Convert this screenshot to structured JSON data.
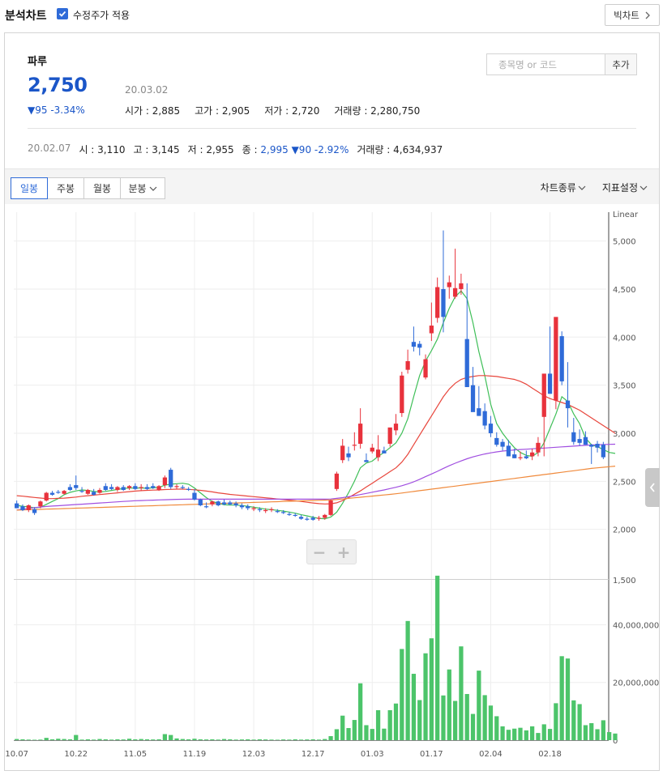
{
  "header": {
    "title": "분석차트",
    "adjusted_label": "수정주가 적용",
    "big_chart_label": "빅차트"
  },
  "stock": {
    "name": "파루",
    "price": "2,750",
    "change": "▼95 -3.34%",
    "date": "20.03.02",
    "open_label": "시가",
    "open": "2,885",
    "high_label": "고가",
    "high": "2,905",
    "low_label": "저가",
    "low": "2,720",
    "volume_label": "거래량",
    "volume": "2,280,750"
  },
  "search": {
    "placeholder": "종목명 or 코드",
    "add_label": "추가"
  },
  "previous": {
    "date": "20.02.07",
    "open_label": "시",
    "open": "3,110",
    "high_label": "고",
    "high": "3,145",
    "low_label": "저",
    "low": "2,955",
    "close_label": "종",
    "close": "2,995",
    "change": "▼90 -2.92%",
    "volume_label": "거래량",
    "volume": "4,634,937"
  },
  "toolbar": {
    "tabs": [
      "일봉",
      "주봉",
      "월봉",
      "분봉"
    ],
    "chart_type_label": "차트종류",
    "indicator_label": "지표설정"
  },
  "colors": {
    "up": "#e8323c",
    "down": "#2f6bd8",
    "ma5": "#3fbf58",
    "ma20": "#e8463c",
    "ma60": "#a04ee0",
    "ma120": "#f08a3c",
    "volume": "#4cc46a"
  },
  "chart_data": {
    "type": "candlestick",
    "price_scale_label": "Linear",
    "x_tick_labels": [
      "10.07",
      "10.22",
      "11.05",
      "11.19",
      "12.03",
      "12.17",
      "01.03",
      "01.17",
      "02.04",
      "02.18"
    ],
    "price_ticks": [
      "5,000",
      "4,500",
      "4,000",
      "3,500",
      "3,000",
      "2,500",
      "2,000",
      "1,500"
    ],
    "volume_ticks": [
      "40,000,000",
      "20,000,000",
      "0"
    ],
    "price_range": [
      1500,
      5300
    ],
    "volume_range": [
      0,
      55000000
    ],
    "candles": [
      [
        2270,
        2300,
        2220,
        2220
      ],
      [
        2240,
        2260,
        2190,
        2200
      ],
      [
        2200,
        2260,
        2180,
        2250
      ],
      [
        2210,
        2230,
        2150,
        2170
      ],
      [
        2240,
        2300,
        2220,
        2290
      ],
      [
        2300,
        2390,
        2290,
        2380
      ],
      [
        2380,
        2400,
        2350,
        2360
      ],
      [
        2390,
        2410,
        2370,
        2380
      ],
      [
        2370,
        2410,
        2360,
        2400
      ],
      [
        2440,
        2470,
        2400,
        2410
      ],
      [
        2460,
        2560,
        2410,
        2430
      ],
      [
        2400,
        2440,
        2380,
        2390
      ],
      [
        2370,
        2420,
        2360,
        2410
      ],
      [
        2390,
        2420,
        2350,
        2360
      ],
      [
        2380,
        2430,
        2370,
        2410
      ],
      [
        2450,
        2480,
        2400,
        2410
      ],
      [
        2440,
        2470,
        2410,
        2420
      ],
      [
        2410,
        2450,
        2390,
        2440
      ],
      [
        2440,
        2460,
        2400,
        2410
      ],
      [
        2430,
        2460,
        2410,
        2450
      ],
      [
        2450,
        2480,
        2410,
        2420
      ],
      [
        2430,
        2470,
        2400,
        2440
      ],
      [
        2440,
        2470,
        2410,
        2420
      ],
      [
        2450,
        2480,
        2420,
        2430
      ],
      [
        2410,
        2460,
        2400,
        2450
      ],
      [
        2460,
        2560,
        2430,
        2540
      ],
      [
        2620,
        2640,
        2420,
        2440
      ],
      [
        2440,
        2470,
        2420,
        2450
      ],
      [
        2440,
        2460,
        2420,
        2430
      ],
      [
        2420,
        2440,
        2400,
        2410
      ],
      [
        2380,
        2420,
        2300,
        2310
      ],
      [
        2310,
        2320,
        2240,
        2250
      ],
      [
        2240,
        2280,
        2220,
        2230
      ],
      [
        2260,
        2300,
        2240,
        2290
      ],
      [
        2290,
        2300,
        2240,
        2250
      ],
      [
        2280,
        2310,
        2250,
        2260
      ],
      [
        2280,
        2300,
        2250,
        2260
      ],
      [
        2270,
        2290,
        2230,
        2250
      ],
      [
        2250,
        2270,
        2210,
        2230
      ],
      [
        2240,
        2260,
        2200,
        2220
      ],
      [
        2210,
        2240,
        2190,
        2220
      ],
      [
        2210,
        2230,
        2180,
        2200
      ],
      [
        2190,
        2220,
        2170,
        2200
      ],
      [
        2200,
        2230,
        2180,
        2210
      ],
      [
        2190,
        2210,
        2170,
        2180
      ],
      [
        2180,
        2200,
        2160,
        2170
      ],
      [
        2160,
        2180,
        2140,
        2150
      ],
      [
        2150,
        2170,
        2130,
        2140
      ],
      [
        2130,
        2150,
        2100,
        2110
      ],
      [
        2110,
        2130,
        2090,
        2100
      ],
      [
        2120,
        2140,
        2090,
        2100
      ],
      [
        2110,
        2140,
        2090,
        2120
      ],
      [
        2120,
        2160,
        2100,
        2150
      ],
      [
        2150,
        2310,
        2140,
        2300
      ],
      [
        2420,
        2600,
        2400,
        2580
      ],
      [
        2720,
        2940,
        2690,
        2870
      ],
      [
        2790,
        2860,
        2710,
        2750
      ],
      [
        2870,
        3010,
        2820,
        2880
      ],
      [
        2890,
        3260,
        2840,
        3100
      ],
      [
        2720,
        2790,
        2700,
        2700
      ],
      [
        2810,
        2890,
        2790,
        2850
      ],
      [
        2750,
        2980,
        2710,
        2830
      ],
      [
        2820,
        2860,
        2800,
        2790
      ],
      [
        2890,
        3040,
        2860,
        3060
      ],
      [
        3030,
        3200,
        2980,
        3100
      ],
      [
        3210,
        3640,
        3170,
        3600
      ],
      [
        3660,
        3870,
        3620,
        3750
      ],
      [
        3950,
        4110,
        3850,
        3900
      ],
      [
        3930,
        3960,
        3810,
        3890
      ],
      [
        3580,
        3820,
        3560,
        3770
      ],
      [
        4040,
        4360,
        3960,
        4120
      ],
      [
        4200,
        4620,
        4150,
        4520
      ],
      [
        4500,
        5110,
        4050,
        4210
      ],
      [
        4520,
        4640,
        4400,
        4570
      ],
      [
        4420,
        4920,
        4400,
        4510
      ],
      [
        4500,
        4660,
        4440,
        4560
      ],
      [
        3980,
        4560,
        3550,
        3480
      ],
      [
        3500,
        3690,
        3280,
        3220
      ],
      [
        3260,
        3490,
        3180,
        3180
      ],
      [
        3230,
        3310,
        3040,
        3080
      ],
      [
        3100,
        3180,
        2960,
        3000
      ],
      [
        2950,
        3010,
        2860,
        2880
      ],
      [
        2910,
        2940,
        2820,
        2860
      ],
      [
        2870,
        2930,
        2760,
        2760
      ],
      [
        2780,
        2840,
        2740,
        2740
      ],
      [
        2740,
        2810,
        2720,
        2750
      ],
      [
        2760,
        2820,
        2730,
        2740
      ],
      [
        2760,
        2840,
        2720,
        2800
      ],
      [
        2800,
        2960,
        2760,
        2900
      ],
      [
        3170,
        3400,
        2760,
        3620
      ],
      [
        3620,
        4110,
        3580,
        3410
      ],
      [
        3340,
        4170,
        3250,
        4210
      ],
      [
        4010,
        4060,
        3500,
        3540
      ],
      [
        3340,
        3740,
        3060,
        3260
      ],
      [
        3010,
        3160,
        2880,
        2910
      ],
      [
        2940,
        3040,
        2870,
        2900
      ],
      [
        2960,
        3020,
        2880,
        2880
      ],
      [
        2880,
        2890,
        2680,
        2860
      ],
      [
        2890,
        2920,
        2800,
        2850
      ],
      [
        2880,
        2910,
        2730,
        2750
      ]
    ],
    "volumes": [
      400000,
      300000,
      200000,
      150000,
      200000,
      800000,
      300000,
      500000,
      400000,
      300000,
      1800000,
      200000,
      300000,
      200000,
      400000,
      300000,
      200000,
      300000,
      250000,
      500000,
      300000,
      400000,
      300000,
      250000,
      300000,
      2100000,
      1800000,
      600000,
      400000,
      300000,
      500000,
      300000,
      250000,
      300000,
      200000,
      400000,
      300000,
      200000,
      250000,
      300000,
      200000,
      300000,
      250000,
      200000,
      150000,
      250000,
      200000,
      300000,
      200000,
      250000,
      300000,
      200000,
      400000,
      1400000,
      3800000,
      8500000,
      4200000,
      7000000,
      19700000,
      5200000,
      3900000,
      10400000,
      4000000,
      10400000,
      12700000,
      31600000,
      41300000,
      23000000,
      13900000,
      30100000,
      35300000,
      57000000,
      15500000,
      24500000,
      13600000,
      32500000,
      16000000,
      9100000,
      24100000,
      15600000,
      12000000,
      8300000,
      4800000,
      3600000,
      4000000,
      4300000,
      3400000,
      4800000,
      2500000,
      5500000,
      3900000,
      12800000,
      29100000,
      28300000,
      13800000,
      12500000,
      5200000,
      5900000,
      3800000,
      6900000,
      2800000,
      2300000
    ],
    "ma_lines": {
      "ma5": [
        2250,
        2240,
        2235,
        2225,
        2230,
        2260,
        2290,
        2320,
        2360,
        2385,
        2400,
        2410,
        2405,
        2395,
        2390,
        2395,
        2405,
        2415,
        2425,
        2430,
        2430,
        2430,
        2428,
        2432,
        2436,
        2460,
        2470,
        2475,
        2480,
        2470,
        2430,
        2380,
        2330,
        2290,
        2270,
        2256,
        2252,
        2252,
        2248,
        2240,
        2230,
        2220,
        2210,
        2204,
        2198,
        2190,
        2180,
        2168,
        2152,
        2140,
        2126,
        2114,
        2110,
        2128,
        2178,
        2272,
        2380,
        2500,
        2640,
        2690,
        2710,
        2760,
        2800,
        2850,
        2900,
        3000,
        3150,
        3380,
        3600,
        3750,
        3860,
        3980,
        4150,
        4300,
        4420,
        4480,
        4400,
        4150,
        3850,
        3600,
        3300,
        3100,
        3000,
        2920,
        2850,
        2800,
        2770,
        2760,
        2800,
        2900,
        3050,
        3200,
        3380,
        3330,
        3200,
        3100,
        2950,
        2880,
        2860,
        2830,
        2800,
        2790
      ],
      "ma20": [
        2350,
        2345,
        2338,
        2332,
        2326,
        2320,
        2320,
        2322,
        2325,
        2330,
        2336,
        2344,
        2350,
        2356,
        2362,
        2368,
        2374,
        2380,
        2386,
        2392,
        2398,
        2402,
        2406,
        2408,
        2410,
        2414,
        2416,
        2418,
        2418,
        2416,
        2412,
        2406,
        2398,
        2390,
        2380,
        2372,
        2364,
        2358,
        2352,
        2346,
        2340,
        2334,
        2328,
        2322,
        2316,
        2310,
        2304,
        2298,
        2290,
        2282,
        2274,
        2268,
        2264,
        2266,
        2276,
        2300,
        2330,
        2365,
        2400,
        2440,
        2480,
        2520,
        2560,
        2600,
        2640,
        2700,
        2780,
        2880,
        2980,
        3080,
        3180,
        3280,
        3380,
        3460,
        3520,
        3560,
        3580,
        3590,
        3600,
        3600,
        3595,
        3590,
        3580,
        3570,
        3560,
        3540,
        3510,
        3470,
        3430,
        3390,
        3360,
        3340,
        3320,
        3300,
        3270,
        3240,
        3200,
        3160,
        3120,
        3080,
        3040,
        3000
      ],
      "ma60": [
        2200,
        2210,
        2218,
        2226,
        2232,
        2238,
        2242,
        2246,
        2250,
        2254,
        2258,
        2262,
        2266,
        2270,
        2274,
        2278,
        2282,
        2286,
        2290,
        2294,
        2298,
        2300,
        2302,
        2304,
        2306,
        2308,
        2310,
        2312,
        2313,
        2314,
        2314,
        2314,
        2314,
        2314,
        2314,
        2314,
        2314,
        2314,
        2314,
        2314,
        2314,
        2314,
        2314,
        2314,
        2314,
        2314,
        2314,
        2314,
        2314,
        2314,
        2314,
        2314,
        2314,
        2316,
        2322,
        2330,
        2340,
        2350,
        2362,
        2374,
        2386,
        2398,
        2410,
        2424,
        2438,
        2454,
        2472,
        2494,
        2520,
        2548,
        2576,
        2604,
        2634,
        2662,
        2688,
        2712,
        2734,
        2754,
        2770,
        2784,
        2796,
        2806,
        2814,
        2820,
        2826,
        2830,
        2834,
        2838,
        2842,
        2846,
        2850,
        2854,
        2858,
        2862,
        2866,
        2870,
        2874,
        2878,
        2880,
        2882,
        2884,
        2886
      ],
      "ma120": [
        2200,
        2202,
        2204,
        2206,
        2208,
        2210,
        2212,
        2214,
        2216,
        2218,
        2220,
        2222,
        2224,
        2226,
        2228,
        2230,
        2232,
        2234,
        2236,
        2238,
        2240,
        2242,
        2244,
        2246,
        2248,
        2250,
        2252,
        2254,
        2256,
        2258,
        2260,
        2262,
        2264,
        2266,
        2268,
        2270,
        2272,
        2274,
        2276,
        2278,
        2280,
        2282,
        2284,
        2286,
        2288,
        2290,
        2292,
        2294,
        2296,
        2298,
        2300,
        2302,
        2304,
        2306,
        2310,
        2316,
        2322,
        2328,
        2334,
        2340,
        2346,
        2352,
        2358,
        2364,
        2370,
        2378,
        2386,
        2394,
        2402,
        2410,
        2418,
        2426,
        2434,
        2442,
        2450,
        2458,
        2466,
        2474,
        2482,
        2490,
        2498,
        2506,
        2514,
        2522,
        2530,
        2538,
        2546,
        2554,
        2562,
        2570,
        2578,
        2586,
        2594,
        2602,
        2610,
        2618,
        2626,
        2634,
        2640,
        2646,
        2652,
        2658
      ]
    }
  }
}
